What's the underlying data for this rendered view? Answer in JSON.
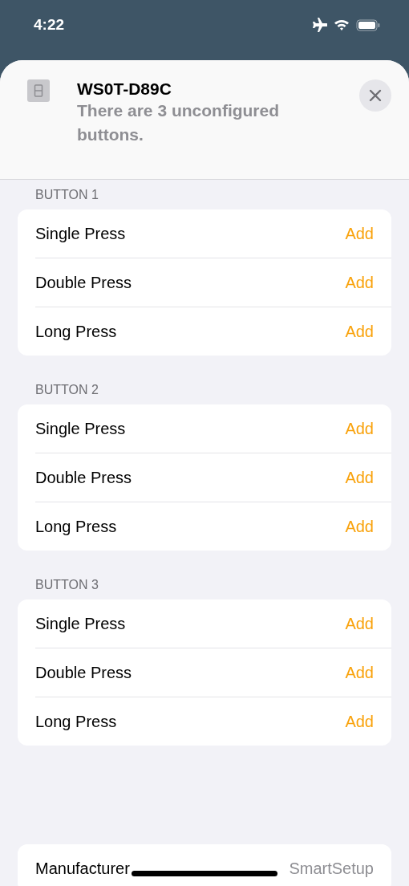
{
  "status_bar": {
    "time": "4:22"
  },
  "header": {
    "title": "WS0T-D89C",
    "subtitle": "There are 3 unconfigured buttons."
  },
  "sections": [
    {
      "title": "BUTTON 1",
      "rows": [
        {
          "label": "Single Press",
          "action": "Add"
        },
        {
          "label": "Double Press",
          "action": "Add"
        },
        {
          "label": "Long Press",
          "action": "Add"
        }
      ]
    },
    {
      "title": "BUTTON 2",
      "rows": [
        {
          "label": "Single Press",
          "action": "Add"
        },
        {
          "label": "Double Press",
          "action": "Add"
        },
        {
          "label": "Long Press",
          "action": "Add"
        }
      ]
    },
    {
      "title": "BUTTON 3",
      "rows": [
        {
          "label": "Single Press",
          "action": "Add"
        },
        {
          "label": "Double Press",
          "action": "Add"
        },
        {
          "label": "Long Press",
          "action": "Add"
        }
      ]
    }
  ],
  "info": [
    {
      "label": "Manufacturer",
      "value": "SmartSetup"
    }
  ]
}
